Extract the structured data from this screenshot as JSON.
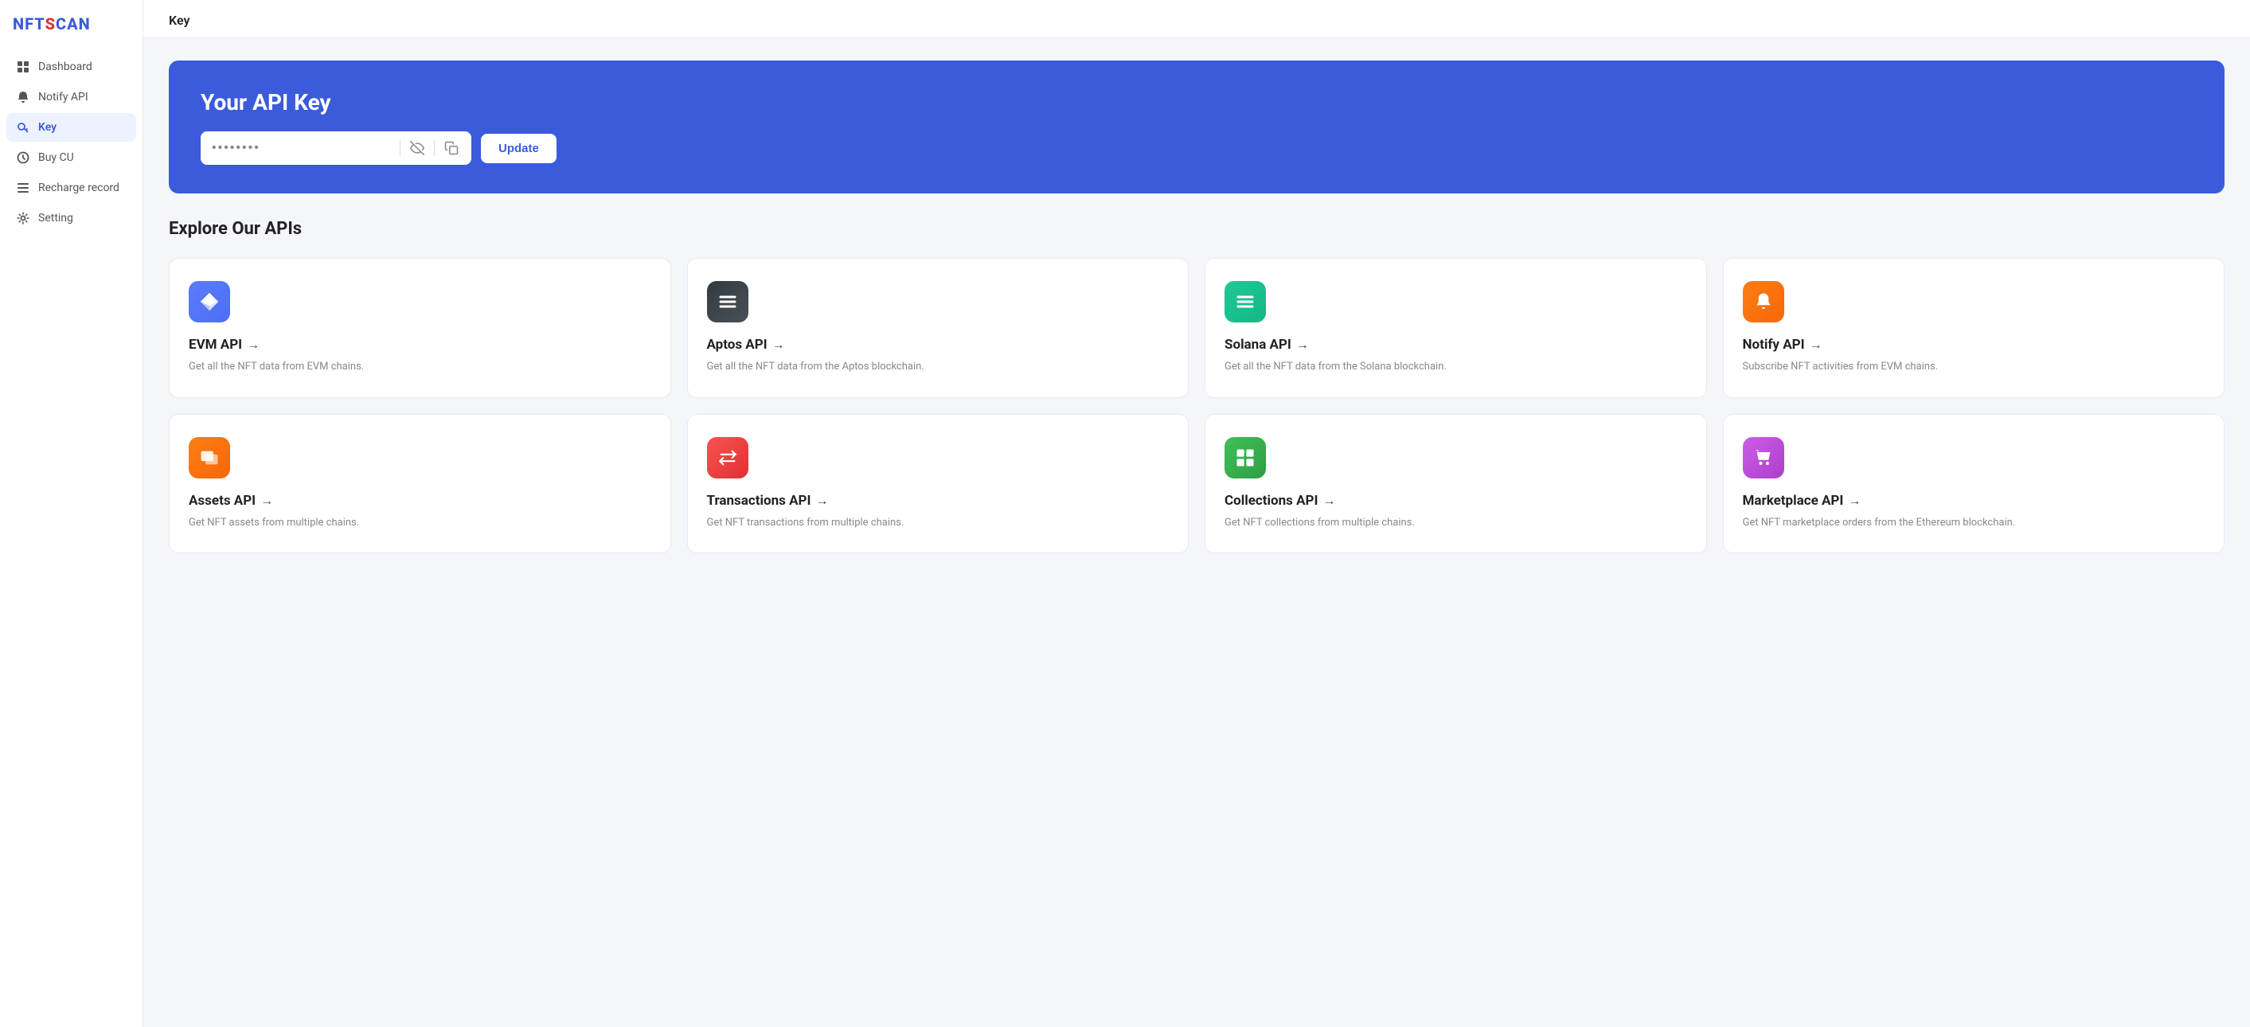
{
  "logo": {
    "text": "NF",
    "accent": "T",
    "rest": "SCAN"
  },
  "sidebar": {
    "items": [
      {
        "id": "dashboard",
        "label": "Dashboard",
        "icon": "grid-icon",
        "active": false
      },
      {
        "id": "notify-api",
        "label": "Notify API",
        "icon": "bell-icon",
        "active": false
      },
      {
        "id": "key",
        "label": "Key",
        "icon": "key-icon",
        "active": true
      },
      {
        "id": "buy-cu",
        "label": "Buy CU",
        "icon": "tag-icon",
        "active": false
      },
      {
        "id": "recharge-record",
        "label": "Recharge record",
        "icon": "list-icon",
        "active": false
      },
      {
        "id": "setting",
        "label": "Setting",
        "icon": "gear-icon",
        "active": false
      }
    ]
  },
  "page_header": "Key",
  "banner": {
    "title": "Your API Key",
    "placeholder": "••••••••",
    "update_label": "Update"
  },
  "explore": {
    "title": "Explore Our APIs",
    "cards": [
      {
        "id": "evm",
        "name": "EVM API",
        "desc": "Get all the NFT data from EVM chains.",
        "icon_color_class": "icon-evm",
        "icon_symbol": "⬡"
      },
      {
        "id": "aptos",
        "name": "Aptos API",
        "desc": "Get all the NFT data from the Aptos blockchain.",
        "icon_color_class": "icon-aptos",
        "icon_symbol": "≡"
      },
      {
        "id": "solana",
        "name": "Solana API",
        "desc": "Get all the NFT data from the Solana blockchain.",
        "icon_color_class": "icon-solana",
        "icon_symbol": "☰"
      },
      {
        "id": "notify",
        "name": "Notify API",
        "desc": "Subscribe NFT activities from EVM chains.",
        "icon_color_class": "icon-notify",
        "icon_symbol": "🔔"
      },
      {
        "id": "assets",
        "name": "Assets API",
        "desc": "Get NFT assets from multiple chains.",
        "icon_color_class": "icon-assets",
        "icon_symbol": "🖼"
      },
      {
        "id": "transactions",
        "name": "Transactions API",
        "desc": "Get NFT transactions from multiple chains.",
        "icon_color_class": "icon-transactions",
        "icon_symbol": "⇄"
      },
      {
        "id": "collections",
        "name": "Collections API",
        "desc": "Get NFT collections from multiple chains.",
        "icon_color_class": "icon-collections",
        "icon_symbol": "⊞"
      },
      {
        "id": "marketplace",
        "name": "Marketplace API",
        "desc": "Get NFT marketplace orders from the Ethereum blockchain.",
        "icon_color_class": "icon-marketplace",
        "icon_symbol": "🛍"
      }
    ]
  }
}
